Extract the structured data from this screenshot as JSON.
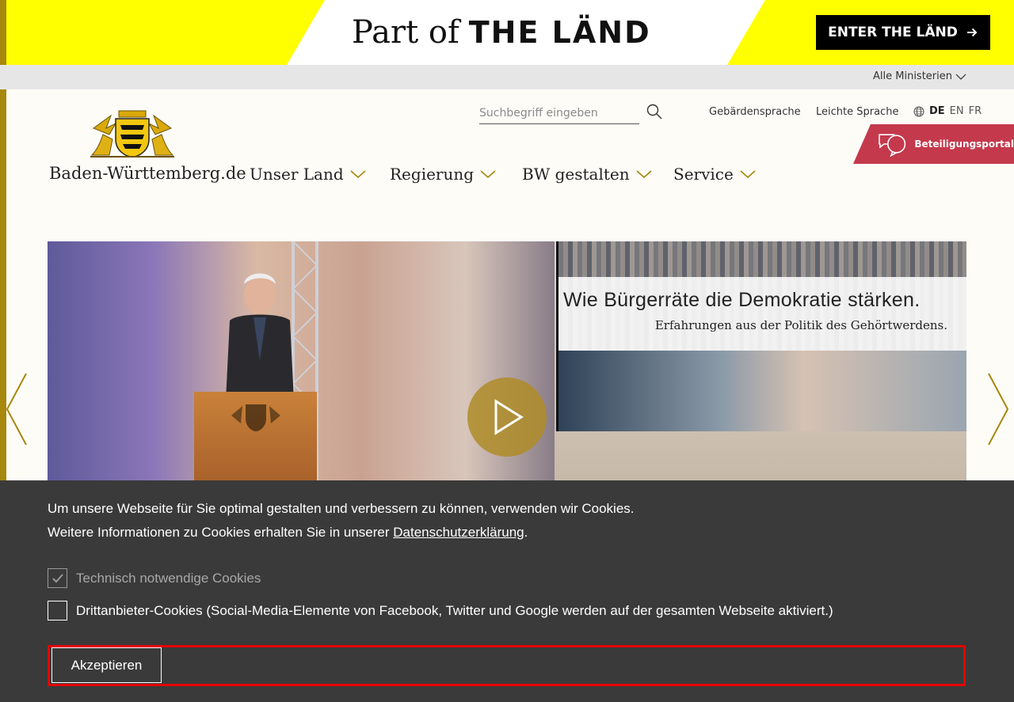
{
  "banner": {
    "part_of": "Part of",
    "land": "THE LÄND",
    "enter_label": "ENTER THE LÄND",
    "arrow_icon": "arrow-right-icon"
  },
  "ministry_bar": {
    "label": "Alle Ministerien"
  },
  "header": {
    "site_name": "Baden-Württemberg.de",
    "search_placeholder": "Suchbegriff eingeben",
    "links": {
      "sign_language": "Gebärdensprache",
      "easy_language": "Leichte Sprache"
    },
    "languages": [
      "DE",
      "EN",
      "FR"
    ],
    "active_language": "DE",
    "portal_label": "Beteiligungsportal"
  },
  "nav": {
    "items": [
      {
        "label": "Unser Land"
      },
      {
        "label": "Regierung"
      },
      {
        "label": "BW gestalten"
      },
      {
        "label": "Service"
      }
    ]
  },
  "hero": {
    "screen_title": "Wie Bürgerräte die Demokratie stärken.",
    "screen_subtitle": "Erfahrungen aus der Politik des Gehörtwerdens."
  },
  "cookie": {
    "line1": "Um unsere Webseite für Sie optimal gestalten und verbessern zu können, verwenden wir Cookies.",
    "line2_prefix": "Weitere Informationen zu Cookies erhalten Sie in unserer ",
    "line2_link": "Datenschutzerklärung",
    "line2_suffix": ".",
    "option_necessary": "Technisch notwendige Cookies",
    "option_third_party": "Drittanbieter-Cookies (Social-Media-Elemente von Facebook, Twitter und Google werden auf der gesamten Webseite aktiviert.)",
    "accept_label": "Akzeptieren"
  },
  "colors": {
    "banner_yellow": "#ffff00",
    "gold": "#a7870c",
    "portal_red": "#c4394c",
    "cookie_bg": "#3a3a3a",
    "focus_red": "#e60000"
  }
}
